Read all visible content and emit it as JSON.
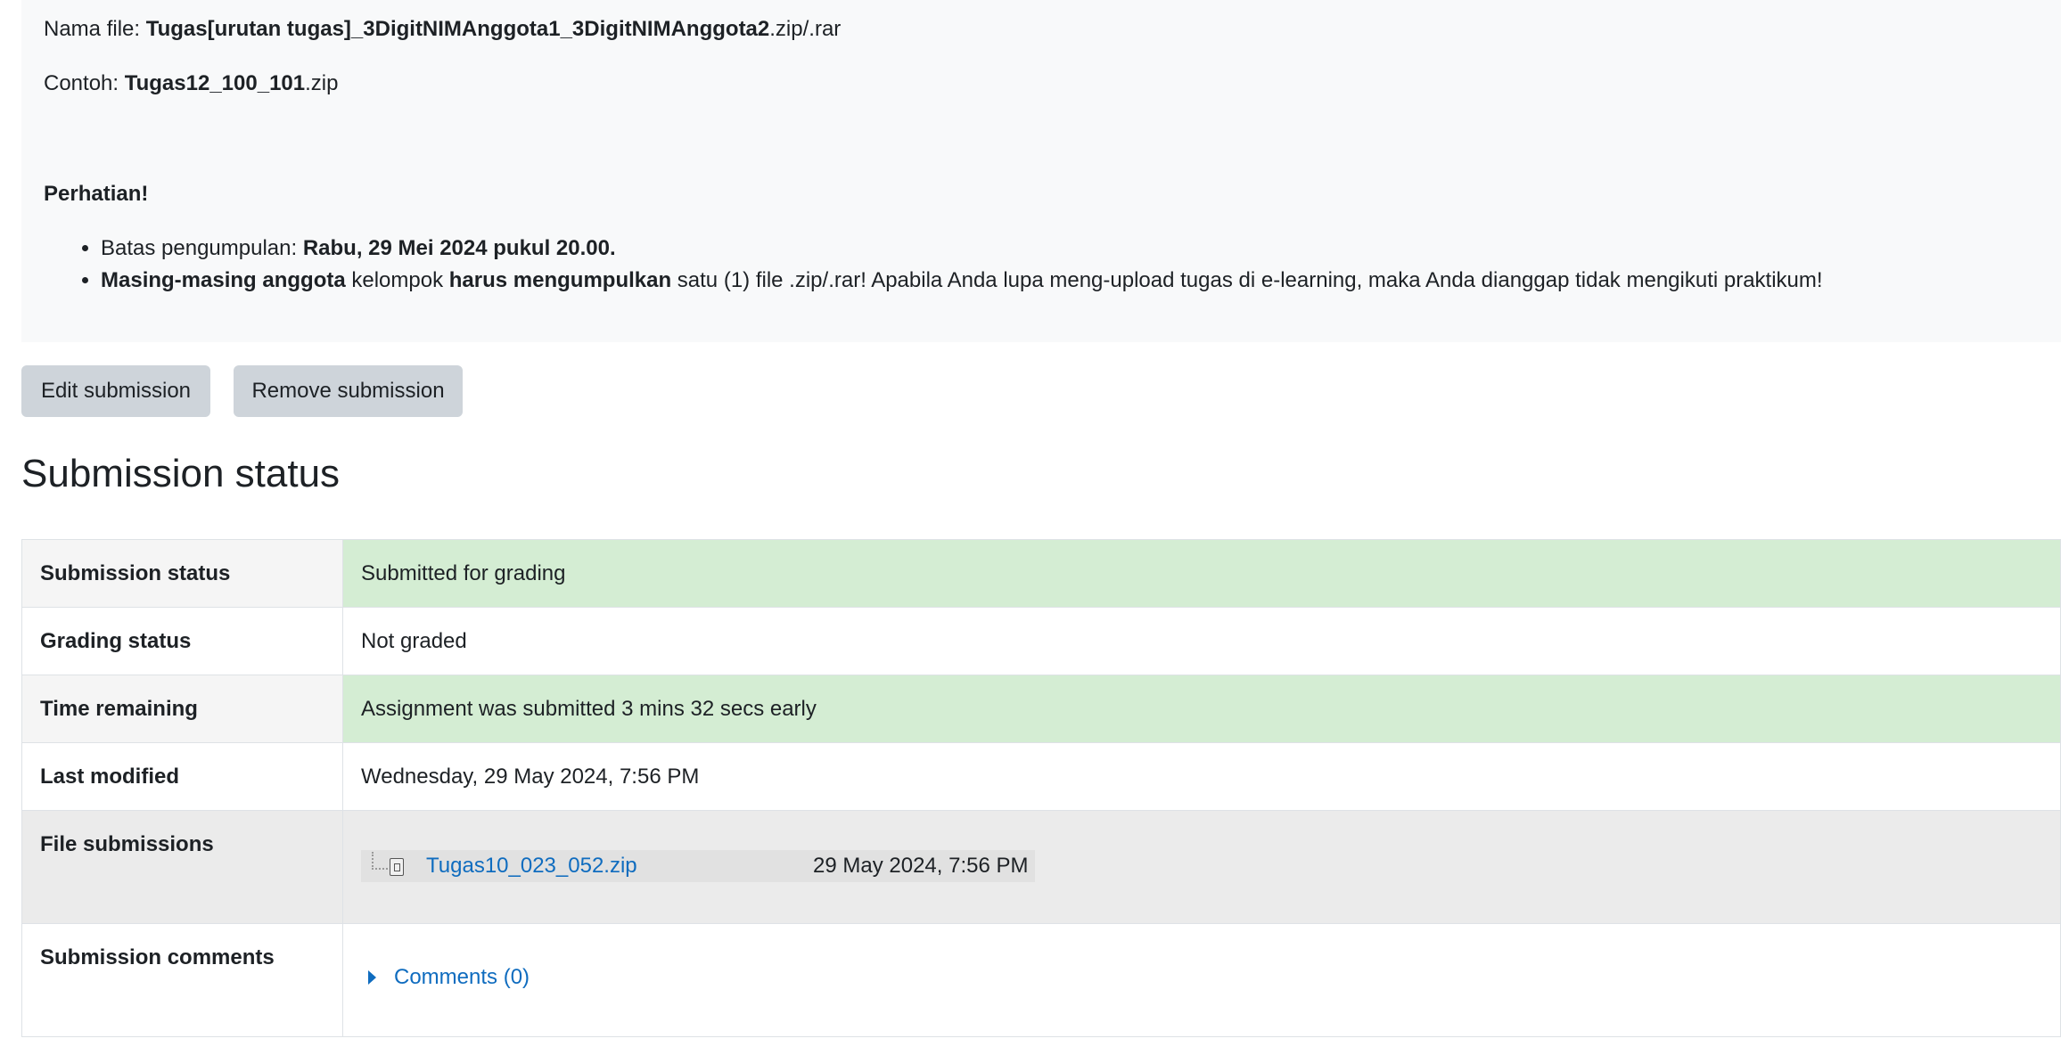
{
  "intro": {
    "filename_prefix": "Nama file: ",
    "filename_bold": "Tugas[urutan tugas]_3DigitNIMAnggota1_3DigitNIMAnggota2",
    "filename_suffix": ".zip/.rar",
    "example_prefix": "Contoh: ",
    "example_bold": "Tugas12_100_101",
    "example_suffix": ".zip",
    "attention": "Perhatian!",
    "bullet1_prefix": "Batas pengumpulan: ",
    "bullet1_bold": "Rabu, 29 Mei 2024 pukul 20.00.",
    "bullet2_bold1": "Masing-masing anggota",
    "bullet2_text1": " kelompok ",
    "bullet2_bold2": "harus mengumpulkan",
    "bullet2_text2": " satu (1) file .zip/.rar! Apabila Anda lupa meng-upload tugas di e-learning, maka Anda dianggap tidak mengikuti praktikum!"
  },
  "buttons": {
    "edit": "Edit submission",
    "remove": "Remove submission"
  },
  "section_title": "Submission status",
  "table": {
    "rows": [
      {
        "label": "Submission status",
        "value": "Submitted for grading"
      },
      {
        "label": "Grading status",
        "value": "Not graded"
      },
      {
        "label": "Time remaining",
        "value": "Assignment was submitted 3 mins 32 secs early"
      },
      {
        "label": "Last modified",
        "value": "Wednesday, 29 May 2024, 7:56 PM"
      },
      {
        "label": "File submissions",
        "file_name": "Tugas10_023_052.zip",
        "file_date": "29 May 2024, 7:56 PM"
      },
      {
        "label": "Submission comments",
        "comments_link": "Comments (0)"
      }
    ]
  },
  "colors": {
    "success_bg": "#d4edd3",
    "link": "#0f6cbf",
    "button_bg": "#ced4da",
    "intro_bg": "#f8f9fa"
  }
}
